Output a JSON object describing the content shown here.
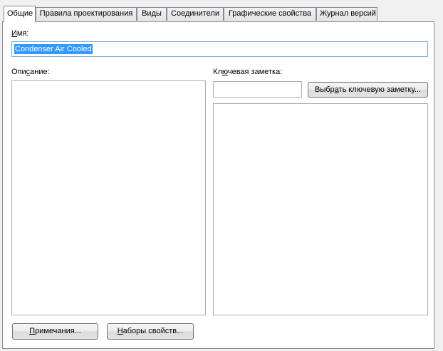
{
  "tabs": [
    {
      "label": "Общие",
      "active": true
    },
    {
      "label": "Правила проектирования",
      "active": false
    },
    {
      "label": "Виды",
      "active": false
    },
    {
      "label": "Соединители",
      "active": false
    },
    {
      "label": "Графические свойства",
      "active": false
    },
    {
      "label": "Журнал версий",
      "active": false
    }
  ],
  "general": {
    "name_label_underlined": "И",
    "name_label_rest": "мя:",
    "name_value": "Condenser Air Cooled",
    "description_label_pre": "Опи",
    "description_label_underlined": "с",
    "description_label_post": "ание:",
    "keynote_label_pre": "Кл",
    "keynote_label_underlined": "ю",
    "keynote_label_post": "чевая заметка:",
    "keynote_value": "",
    "select_keynote_button_pre": "Выбр",
    "select_keynote_button_underlined": "а",
    "select_keynote_button_post": "ть ключевую заметку...",
    "notes_button_underlined": "П",
    "notes_button_rest": "римечания...",
    "property_sets_button_underlined": "Н",
    "property_sets_button_rest": "аборы свойств..."
  },
  "colors": {
    "selection": "#3399ff",
    "focus_border": "#7aa7d6",
    "panel_bg": "#ffffff",
    "window_bg": "#f0f0f0"
  }
}
